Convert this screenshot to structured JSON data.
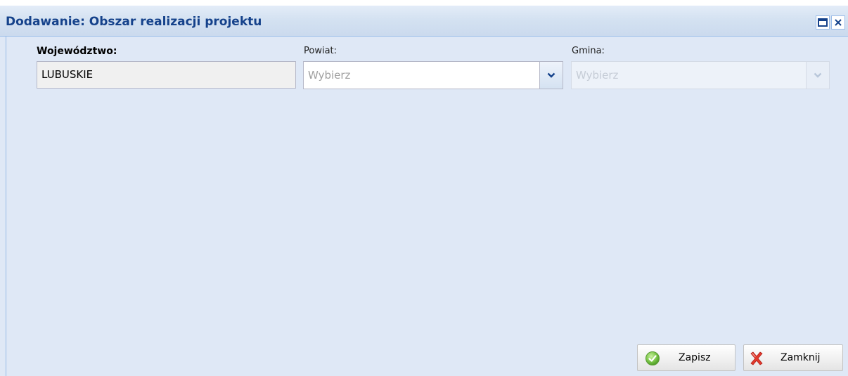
{
  "window": {
    "title": "Dodawanie: Obszar realizacji projektu",
    "tools": [
      {
        "name": "maximize",
        "icon": "maximize-icon"
      },
      {
        "name": "close",
        "icon": "close-icon"
      }
    ]
  },
  "form": {
    "wojewodztwo": {
      "label": "Województwo:",
      "value": "LUBUSKIE"
    },
    "powiat": {
      "label": "Powiat:",
      "placeholder": "Wybierz",
      "icon": "chevron-down-icon"
    },
    "gmina": {
      "label": "Gmina:",
      "placeholder": "Wybierz",
      "icon": "chevron-down-icon",
      "disabled": true
    }
  },
  "buttons": {
    "save": {
      "label": "Zapisz",
      "icon": "check-icon"
    },
    "close": {
      "label": "Zamknij",
      "icon": "cross-icon"
    }
  },
  "colors": {
    "title": "#15428b",
    "body": "#dfe8f6",
    "border": "#99bbe8"
  }
}
